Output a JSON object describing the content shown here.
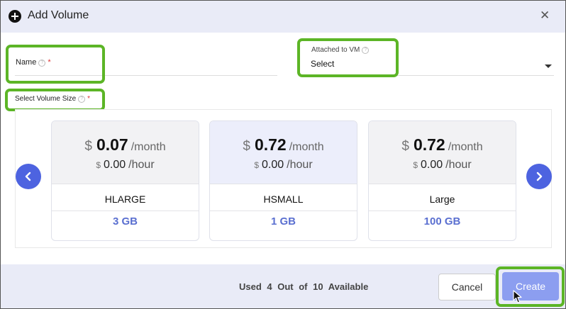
{
  "dialog": {
    "title": "Add Volume",
    "close_icon": "close-icon",
    "add_icon": "add-circle-icon"
  },
  "form": {
    "name": {
      "label": "Name",
      "required_mark": "*",
      "value": "",
      "help_icon": "help-icon"
    },
    "attached_vm": {
      "label": "Attached to VM",
      "value": "Select",
      "help_icon": "help-icon",
      "caret_icon": "caret-down-icon"
    },
    "volume_size": {
      "label": "Select Volume Size",
      "required_mark": "*",
      "help_icon": "help-icon"
    }
  },
  "plans": [
    {
      "currency": "$",
      "monthly_price": "0.07",
      "monthly_unit": "/month",
      "hourly_price": "0.00",
      "hourly_unit": "/hour",
      "name": "HLARGE",
      "size": "3 GB"
    },
    {
      "currency": "$",
      "monthly_price": "0.72",
      "monthly_unit": "/month",
      "hourly_price": "0.00",
      "hourly_unit": "/hour",
      "name": "HSMALL",
      "size": "1 GB"
    },
    {
      "currency": "$",
      "monthly_price": "0.72",
      "monthly_unit": "/month",
      "hourly_price": "0.00",
      "hourly_unit": "/hour",
      "name": "Large",
      "size": "100 GB"
    }
  ],
  "carousel": {
    "prev_icon": "chevron-left-icon",
    "next_icon": "chevron-right-icon"
  },
  "footer": {
    "usage_text": "Used 4 Out of 10 Available",
    "cancel_label": "Cancel",
    "create_label": "Create"
  },
  "colors": {
    "header_bg": "#e9ebf7",
    "accent": "#4d63e0",
    "highlight": "#5cb526",
    "create_button": "#8c9ef0",
    "size_text": "#5a6fd0"
  }
}
